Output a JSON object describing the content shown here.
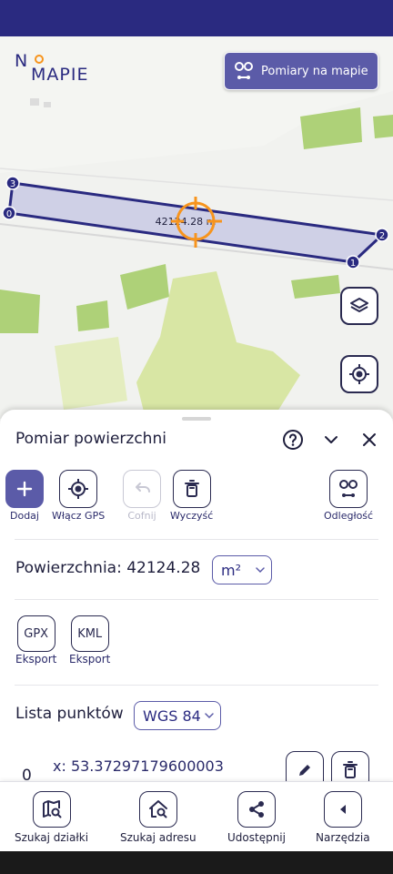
{
  "app": {
    "logo_line1": "N",
    "logo_line2": "MAPIE",
    "measure_button": "Pomiary na mapie",
    "accent": "#5b5ba8",
    "dark": "#2a2a80"
  },
  "map": {
    "area_label": "42124.28 m",
    "vertices": [
      "0",
      "1",
      "2",
      "3"
    ]
  },
  "panel": {
    "title": "Pomiar powierzchni",
    "tools": {
      "add": "Dodaj",
      "gps": "Włącz GPS",
      "undo": "Cofnij",
      "clear": "Wyczyść",
      "distance": "Odległość"
    },
    "area_prefix": "Powierzchnia:",
    "area_value": "42124.28",
    "unit": "m²",
    "exports": [
      {
        "format": "GPX",
        "label": "Eksport"
      },
      {
        "format": "KML",
        "label": "Eksport"
      }
    ],
    "points_label": "Lista punktów",
    "crs": "WGS 84",
    "points": [
      {
        "index": "0",
        "x": "x: 53.37297179600003"
      }
    ]
  },
  "bottom_nav": [
    {
      "label": "Szukaj działki"
    },
    {
      "label": "Szukaj adresu"
    },
    {
      "label": "Udostępnij"
    },
    {
      "label": "Narzędzia"
    }
  ]
}
